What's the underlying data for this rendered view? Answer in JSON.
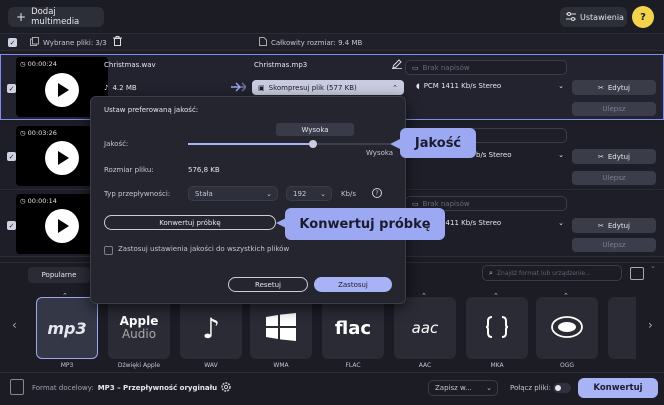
{
  "toolbar": {
    "add_media": "Dodaj multimedia",
    "settings": "Ustawienia",
    "help": "?"
  },
  "subbar": {
    "selected_files": "Wybrane pliki: 3/3",
    "total_size": "Całkowity rozmiar: 9.4 MB"
  },
  "files": [
    {
      "duration": "00:00:24",
      "name": "Christmas.wav",
      "size": "4.2 MB",
      "output": "Christmas.mp3",
      "compress": "Skompresuj plik (577 KB)",
      "subtitles": "Brak napisów",
      "audio": "PCM 1411 Kb/s Stereo",
      "edit": "Edytuj",
      "improve": "Ulepsz"
    },
    {
      "duration": "00:03:26",
      "audio": "b/s Stereo",
      "edit": "Edytuj",
      "improve": "Ulepsz"
    },
    {
      "duration": "00:00:14",
      "subtitles": "Brak napisów",
      "audio": "PCM 1411 Kb/s Stereo",
      "edit": "Edytuj",
      "improve": "Ulepsz"
    }
  ],
  "popup": {
    "title": "Ustaw preferowaną jakość:",
    "quality_label": "Jakość:",
    "quality_value": "Wysoka",
    "quality_level": 0.62,
    "filesize_label": "Rozmiar pliku:",
    "filesize_value": "576,8 KB",
    "bitrate_type_label": "Typ przepływności:",
    "bitrate_type": "Stała",
    "bitrate_value": "192",
    "bitrate_unit": "Kb/s",
    "info": "?",
    "convert_sample": "Konwertuj próbkę",
    "apply_all": "Zastosuj ustawienia jakości do wszystkich plików",
    "reset": "Resetuj",
    "apply": "Zastosuj"
  },
  "callouts": {
    "quality": "Jakość",
    "convert_sample": "Konwertuj próbkę"
  },
  "formats": {
    "tab_popular": "Popularne",
    "search_placeholder": "Znajdź format lub urządzenie...",
    "items": [
      {
        "label": "MP3",
        "icon": "mp3-icon"
      },
      {
        "label": "Dźwięki Apple",
        "icon": "apple-audio-icon",
        "logo_top": "Apple",
        "logo_bottom": "Audio"
      },
      {
        "label": "WAV",
        "icon": "music-note-icon"
      },
      {
        "label": "WMA",
        "icon": "windows-icon"
      },
      {
        "label": "FLAC",
        "icon": "flac-icon",
        "logo": "flac"
      },
      {
        "label": "AAC",
        "icon": "aac-icon",
        "logo": "aac"
      },
      {
        "label": "MKA",
        "icon": "mka-icon"
      },
      {
        "label": "OGG",
        "icon": "ogg-icon"
      }
    ]
  },
  "bottom": {
    "target_format_label": "Format docelowy:",
    "target_format_value": "MP3 – Przepływność oryginału",
    "save_to": "Zapisz w...",
    "merge_files": "Połącz pliki:",
    "convert": "Konwertuj"
  },
  "colors": {
    "accent": "#a8b3f6",
    "help": "#f3d34a",
    "selected_border": "#7f8cf0"
  }
}
